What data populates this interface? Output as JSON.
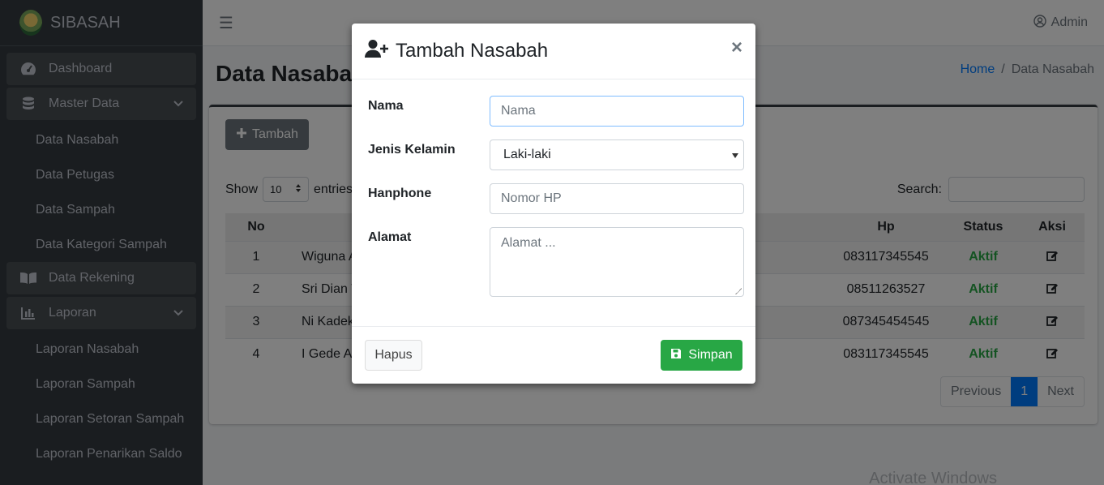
{
  "brand": {
    "name": "SIBASAH"
  },
  "sidebar": {
    "items": [
      {
        "label": "Dashboard",
        "icon": "tachometer-icon"
      },
      {
        "label": "Master Data",
        "icon": "database-icon"
      },
      {
        "label": "Data Nasabah"
      },
      {
        "label": "Data Petugas"
      },
      {
        "label": "Data Sampah"
      },
      {
        "label": "Data Kategori Sampah"
      },
      {
        "label": "Data Rekening",
        "icon": "book-icon"
      },
      {
        "label": "Laporan",
        "icon": "chart-icon"
      },
      {
        "label": "Laporan Nasabah"
      },
      {
        "label": "Laporan Sampah"
      },
      {
        "label": "Laporan Setoran Sampah"
      },
      {
        "label": "Laporan Penarikan Saldo"
      }
    ]
  },
  "topbar": {
    "user": "Admin"
  },
  "page": {
    "title": "Data Nasabah",
    "breadcrumb": {
      "home": "Home",
      "current": "Data Nasabah"
    }
  },
  "card": {
    "add_button": "Tambah",
    "show_label": "Show",
    "entries_value": "10",
    "entries_label": "entries",
    "search_label": "Search:"
  },
  "table": {
    "headers": {
      "no": "No",
      "hp": "Hp",
      "status": "Status",
      "aksi": "Aksi"
    },
    "rows": [
      {
        "no": "1",
        "nama": "Wiguna Art",
        "hp": "083117345545",
        "status": "Aktif"
      },
      {
        "no": "2",
        "nama": "Sri Dian Wi",
        "hp": "08511263527",
        "status": "Aktif"
      },
      {
        "no": "3",
        "nama": "Ni Kadek Y",
        "hp": "087345454545",
        "status": "Aktif"
      },
      {
        "no": "4",
        "nama": "I Gede Arta",
        "hp": "083117345545",
        "status": "Aktif"
      }
    ]
  },
  "pagination": {
    "previous": "Previous",
    "current": "1",
    "next": "Next"
  },
  "watermark": "Activate Windows",
  "modal": {
    "title": "Tambah Nasabah",
    "close": "×",
    "fields": {
      "nama": {
        "label": "Nama",
        "placeholder": "Nama"
      },
      "jenis_kelamin": {
        "label": "Jenis Kelamin",
        "value": "Laki-laki"
      },
      "hanphone": {
        "label": "Hanphone",
        "placeholder": "Nomor HP"
      },
      "alamat": {
        "label": "Alamat",
        "placeholder": "Alamat ..."
      }
    },
    "reset_button": "Hapus",
    "save_button": "Simpan"
  },
  "colors": {
    "sidebar": "#343a40",
    "primary": "#007bff",
    "success": "#28a745",
    "secondary": "#6c757d"
  }
}
